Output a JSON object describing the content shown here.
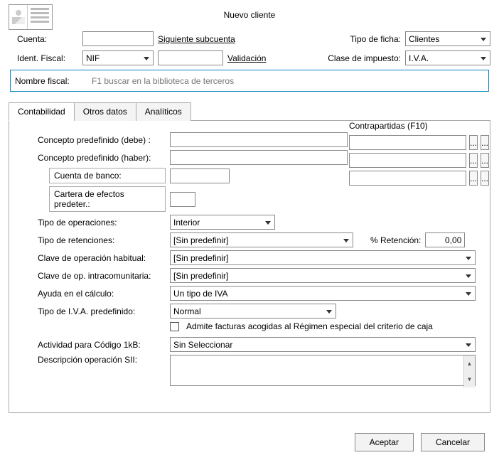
{
  "title": "Nuevo cliente",
  "header": {
    "cuenta_label": "Cuenta:",
    "siguiente_subcuenta": "Siguiente subcuenta",
    "tipo_ficha_label": "Tipo de ficha:",
    "tipo_ficha_value": "Clientes",
    "ident_fiscal_label": "Ident. Fiscal:",
    "ident_fiscal_value": "NIF",
    "validacion": "Validación",
    "clase_impuesto_label": "Clase de impuesto:",
    "clase_impuesto_value": "I.V.A.",
    "nombre_fiscal_label": "Nombre fiscal:",
    "nombre_fiscal_placeholder": "F1 buscar en la biblioteca de terceros"
  },
  "tabs": {
    "contabilidad": "Contabilidad",
    "otros_datos": "Otros datos",
    "analiticos": "Analíticos"
  },
  "form": {
    "concepto_debe": "Concepto predefinido (debe) :",
    "concepto_haber": "Concepto predefinido (haber):",
    "cuenta_banco": "Cuenta de banco:",
    "cartera_efectos": "Cartera de efectos predeter.:",
    "tipo_operaciones_label": "Tipo de operaciones:",
    "tipo_operaciones_value": "Interior",
    "tipo_retenciones_label": "Tipo de retenciones:",
    "tipo_retenciones_value": "[Sin predefinir]",
    "pct_retencion_label": "% Retención:",
    "pct_retencion_value": "0,00",
    "clave_habitual_label": "Clave de operación habitual:",
    "clave_habitual_value": "[Sin predefinir]",
    "clave_intra_label": "Clave de op. intracomunitaria:",
    "clave_intra_value": "[Sin predefinir]",
    "ayuda_calculo_label": "Ayuda en el cálculo:",
    "ayuda_calculo_value": "Un tipo de IVA",
    "tipo_iva_label": "Tipo de I.V.A. predefinido:",
    "tipo_iva_value": "Normal",
    "admite_facturas": "Admite facturas acogidas al Régimen especial del criterio de caja",
    "actividad_1kb_label": "Actividad para Código 1kB:",
    "actividad_1kb_value": "Sin Seleccionar",
    "descripcion_sii_label": "Descripción operación SII:"
  },
  "contrapartidas": {
    "title": "Contrapartidas (F10)",
    "ellipsis": "..."
  },
  "footer": {
    "aceptar": "Aceptar",
    "cancelar": "Cancelar"
  }
}
